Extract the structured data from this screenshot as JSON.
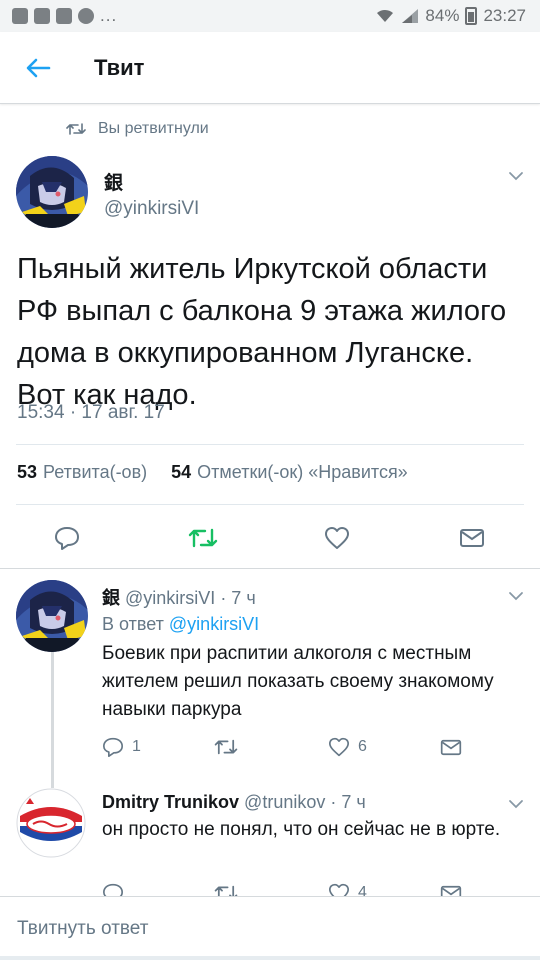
{
  "status_bar": {
    "dots": "...",
    "battery": "84%",
    "time": "23:27"
  },
  "header": {
    "title": "Твит"
  },
  "retweet_indicator": {
    "text": "Вы ретвитнули"
  },
  "tweet": {
    "author_name": "銀",
    "author_handle": "@yinkirsiVI",
    "text": "Пьяный житель Иркутской области РФ выпал с балкона 9 этажа жилого дома в оккупированном Луганске. Вот как надо.",
    "timestamp": "15:34 · 17 авг. 17",
    "retweets_count": "53",
    "retweets_label": "Ретвита(-ов)",
    "likes_count": "54",
    "likes_label": "Отметки(-ок) «Нравится»",
    "retweeted": true
  },
  "replies": [
    {
      "author_name": "銀",
      "author_handle": "@yinkirsiVI",
      "age": "· 7 ч",
      "reply_to_label": "В ответ",
      "reply_to_handle": "@yinkirsiVI",
      "text": "Боевик при распитии алкоголя с местным жителем решил показать своему знакомому навыки паркура",
      "reply_count": "1",
      "retweet_count": "",
      "like_count": "6"
    },
    {
      "author_name": "Dmitry Trunikov",
      "author_handle": "@trunikov",
      "age": "· 7 ч",
      "text": "он просто не понял, что он сейчас не в юрте.",
      "reply_count": "",
      "retweet_count": "",
      "like_count": "4"
    }
  ],
  "compose": {
    "placeholder": "Твитнуть ответ"
  },
  "colors": {
    "accent": "#1da1f2",
    "retweet_green": "#17bf63",
    "secondary_text": "#657786",
    "primary_text": "#14171a"
  }
}
